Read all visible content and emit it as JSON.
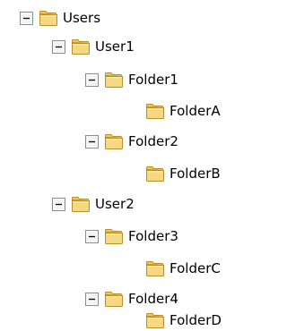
{
  "tree": {
    "users": {
      "label": "Users",
      "expander": "minus-box-icon",
      "icon": "folder-icon"
    },
    "user1": {
      "label": "User1",
      "expander": "minus-box-icon",
      "icon": "folder-icon"
    },
    "folder1": {
      "label": "Folder1",
      "expander": "minus-box-icon",
      "icon": "folder-icon"
    },
    "folderA": {
      "label": "FolderA",
      "icon": "folder-icon"
    },
    "folder2": {
      "label": "Folder2",
      "expander": "minus-box-icon",
      "icon": "folder-icon"
    },
    "folderB": {
      "label": "FolderB",
      "icon": "folder-icon"
    },
    "user2": {
      "label": "User2",
      "expander": "minus-box-icon",
      "icon": "folder-icon"
    },
    "folder3": {
      "label": "Folder3",
      "expander": "minus-box-icon",
      "icon": "folder-icon"
    },
    "folderC": {
      "label": "FolderC",
      "icon": "folder-icon"
    },
    "folder4": {
      "label": "Folder4",
      "expander": "minus-box-icon",
      "icon": "folder-icon"
    },
    "folderD": {
      "label": "FolderD",
      "icon": "folder-icon"
    }
  },
  "colors": {
    "expander_border": "#8c8c8c",
    "expander_sign": "#000000",
    "folder_fill": "#f5d982",
    "folder_outline": "#b88e2a",
    "background": "#ffffff"
  }
}
